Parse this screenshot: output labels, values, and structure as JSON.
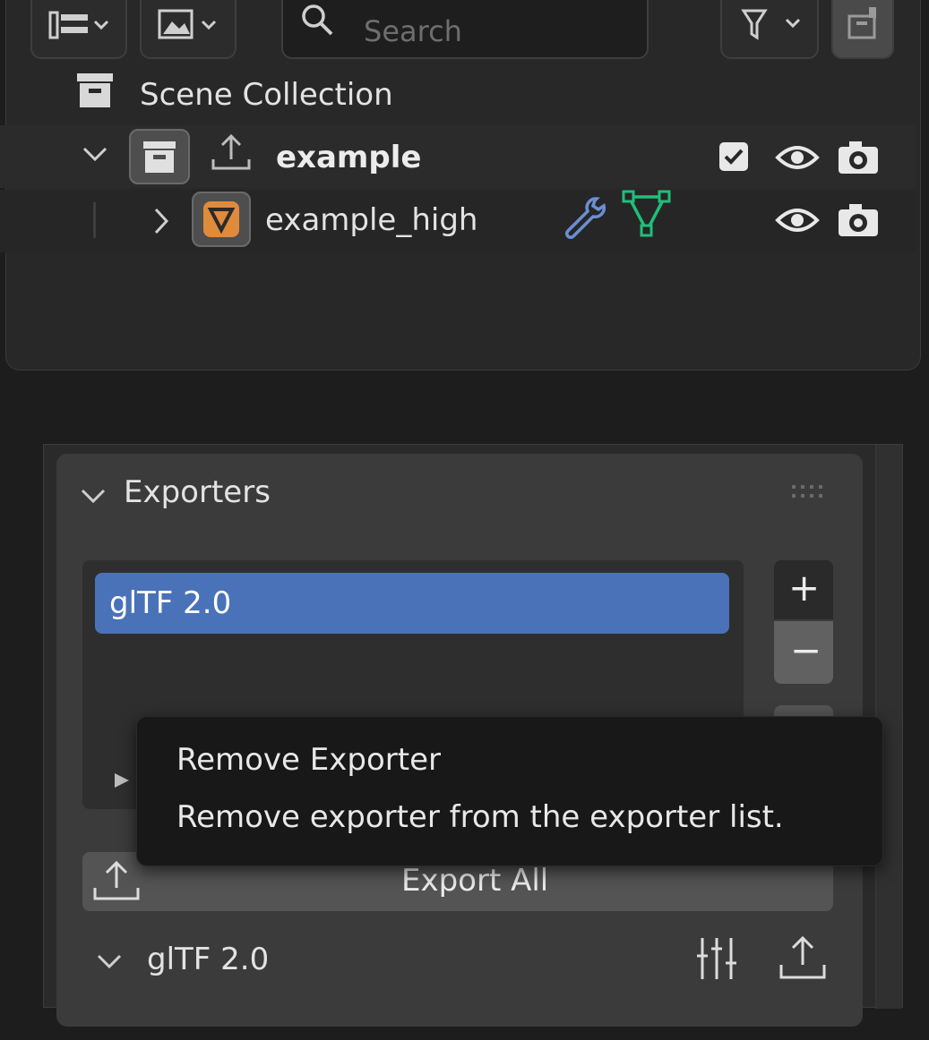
{
  "colors": {
    "selection": "#4a72b8",
    "modifier_wrench": "#6b8fd6",
    "mesh_data": "#1fbf7a",
    "object_orange": "#e08a3c"
  },
  "outliner": {
    "search_placeholder": "Search",
    "rows": [
      {
        "label": "Scene Collection",
        "icon": "collection-box-icon"
      },
      {
        "label": "example",
        "icon": "collection-box-icon",
        "checkbox": true,
        "visible": true,
        "renderable": true
      },
      {
        "label": "example_high",
        "icon": "mesh-object-icon",
        "modifiers": [
          "wrench-icon",
          "mesh-data-icon"
        ],
        "visible": true,
        "renderable": true
      }
    ]
  },
  "exporters_panel": {
    "title": "Exporters",
    "list": [
      "glTF 2.0"
    ],
    "add_label": "+",
    "remove_label": "−",
    "export_all_label": "Export All",
    "sub_panel_title": "glTF 2.0"
  },
  "tooltip": {
    "title": "Remove Exporter",
    "description": "Remove exporter from the exporter list."
  }
}
